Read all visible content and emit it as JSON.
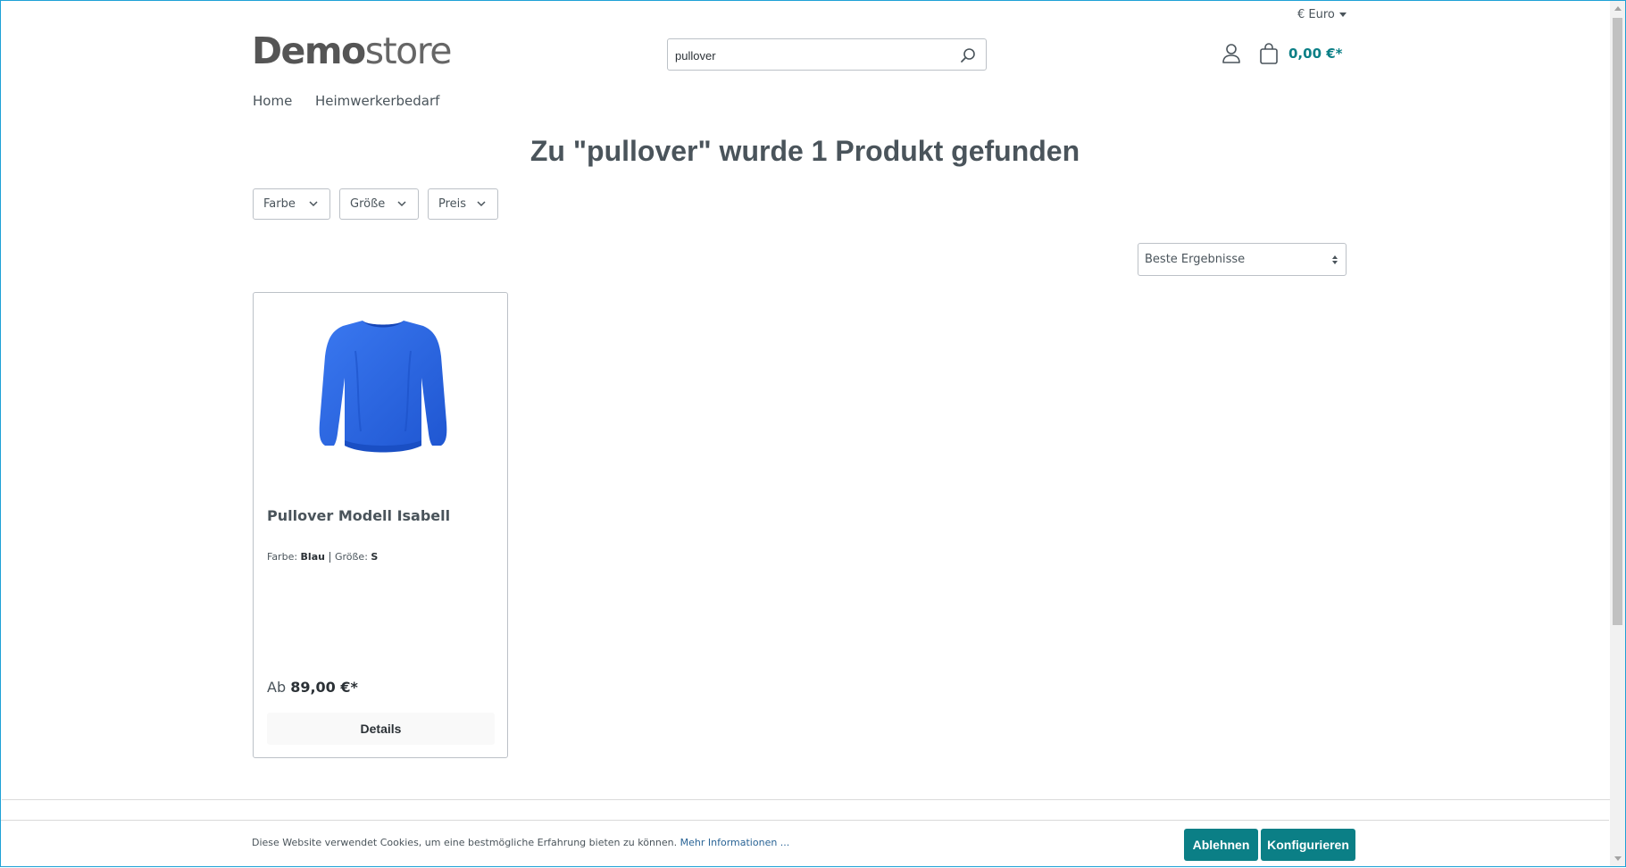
{
  "header": {
    "currency_label": "€ Euro",
    "logo": {
      "bold": "Demo",
      "light": "store"
    },
    "search": {
      "value": "pullover",
      "placeholder": ""
    },
    "cart_total": "0,00 €*"
  },
  "nav": {
    "items": [
      "Home",
      "Heimwerkerbedarf"
    ]
  },
  "results_heading": "Zu \"pullover\" wurde 1 Produkt gefunden",
  "filters": [
    "Farbe",
    "Größe",
    "Preis"
  ],
  "sort": {
    "selected": "Beste Ergebnisse"
  },
  "products": [
    {
      "name": "Pullover Modell Isabell",
      "variant_color_label": "Farbe:",
      "variant_color_value": "Blau",
      "variant_size_label": "Größe:",
      "variant_size_value": "S",
      "price_prefix": "Ab",
      "price": "89,00 €*",
      "details_label": "Details",
      "image_color": "#2d6ae8"
    }
  ],
  "cookie": {
    "text": "Diese Website verwendet Cookies, um eine bestmögliche Erfahrung bieten zu können.",
    "link": "Mehr Informationen ...",
    "decline_label": "Ablehnen",
    "configure_label": "Konfigurieren"
  },
  "colors": {
    "accent": "#0b7f86",
    "text": "#4a545b",
    "border": "#bcc1c7"
  }
}
